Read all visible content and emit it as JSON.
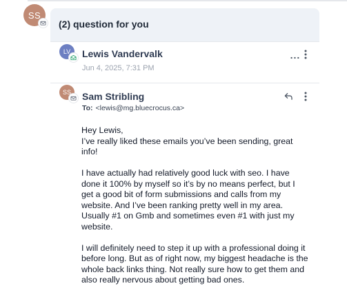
{
  "thread": {
    "avatar_initials": "SS",
    "title": "(2) question for you"
  },
  "messages": [
    {
      "avatar_initials": "LV",
      "avatar_color": "#6d7fc2",
      "sender": "Lewis Vandervalk",
      "date": "Jun 4, 2025, 7:31 PM",
      "more_label": "...",
      "collapsed": true
    },
    {
      "avatar_initials": "SS",
      "avatar_color": "#c08a74",
      "sender": "Sam Stribling",
      "to_label": "To:",
      "to_address": "<lewis@mg.bluecrocus.ca>",
      "body": {
        "greeting": "Hey Lewis,",
        "p1": "I’ve really liked these emails you’ve been sending, great info!",
        "p2": "I have actually had relatively good luck with seo. I have done it 100% by myself so it’s by no means perfect, but I get a good bit of form submissions and calls from my website. And I’ve been ranking pretty well in my area. Usually #1 on Gmb and sometimes even #1 with just my website.",
        "p3": "I will definitely need to step it up with a professional doing it before long. But as of right now, my biggest headache is the whole back links thing. Not really sure how to get them and also really nervous about getting bad ones."
      }
    }
  ],
  "icons": [
    "mail-badge-icon",
    "reply-icon",
    "more-vertical-icon"
  ]
}
